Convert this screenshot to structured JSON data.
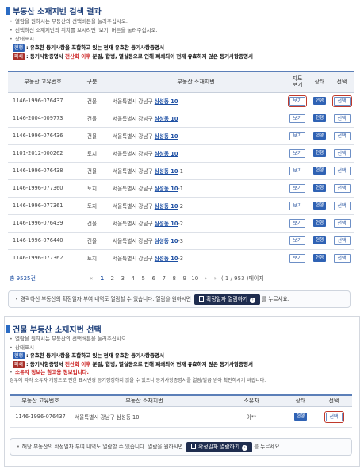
{
  "section1": {
    "title": "부동산 소재지번 검색 결과",
    "bullets": [
      "열람을 원하시는 부동산의 선택버튼을 눌러주십시오.",
      "선택하신 소재지번의 위치를 보시려면 '보기' 버튼을 눌러주십시오.",
      "상태표시"
    ],
    "legend_current_badge": "현행",
    "legend_current_text": ": 유효한 등기사항을 포함하고 있는 현재 유효한 등기사항증명서",
    "legend_closed_badge": "폐쇄",
    "legend_closed_pre": ": 등기사항증명서 ",
    "legend_closed_red": "전산화 이후",
    "legend_closed_post": " 분필, 합병, 멸실등으로 인해 폐쇄되어 현재 유효하지 않은 등기사항증명서",
    "columns": [
      "부동산 고유번호",
      "구분",
      "부동산 소재지번",
      "지도\n보기",
      "상태",
      "선택"
    ],
    "view_label": "보기",
    "status_label": "현행",
    "select_label": "선택",
    "rows": [
      {
        "id": "1146-1996-076437",
        "type": "건물",
        "addr": "서울특별시 강남구 ",
        "link": "삼성동 10",
        "suffix": ""
      },
      {
        "id": "1146-2004-009773",
        "type": "건물",
        "addr": "서울특별시 강남구 ",
        "link": "삼성동 10",
        "suffix": ""
      },
      {
        "id": "1146-1996-076436",
        "type": "건물",
        "addr": "서울특별시 강남구 ",
        "link": "삼성동 10",
        "suffix": ""
      },
      {
        "id": "1101-2012-000262",
        "type": "토지",
        "addr": "서울특별시 강남구 ",
        "link": "삼성동 10",
        "suffix": ""
      },
      {
        "id": "1146-1996-076438",
        "type": "건물",
        "addr": "서울특별시 강남구 ",
        "link": "삼성동 10",
        "suffix": "-1"
      },
      {
        "id": "1146-1996-077360",
        "type": "토지",
        "addr": "서울특별시 강남구 ",
        "link": "삼성동 10",
        "suffix": "-1"
      },
      {
        "id": "1146-1996-077361",
        "type": "토지",
        "addr": "서울특별시 강남구 ",
        "link": "삼성동 10",
        "suffix": "-2"
      },
      {
        "id": "1146-1996-076439",
        "type": "건물",
        "addr": "서울특별시 강남구 ",
        "link": "삼성동 10",
        "suffix": "-2"
      },
      {
        "id": "1146-1996-076440",
        "type": "건물",
        "addr": "서울특별시 강남구 ",
        "link": "삼성동 10",
        "suffix": "-3"
      },
      {
        "id": "1146-1996-077362",
        "type": "토지",
        "addr": "서울특별시 강남구 ",
        "link": "삼성동 10",
        "suffix": "-3"
      }
    ],
    "total": "총 9525건",
    "pages": [
      "1",
      "2",
      "3",
      "4",
      "5",
      "6",
      "7",
      "8",
      "9",
      "10"
    ],
    "current_page": "1",
    "page_info": "( 1 / 953 )페이지",
    "notice_pre": "경락하신 부동산의 확정일자 부여 내역도 열람할 수 있습니다. 열람을 원하시면",
    "notice_button": "확정일자 열람하기",
    "notice_post": "를 누르세요."
  },
  "section2": {
    "title": "건물 부동산 소재지번 선택",
    "bullets": [
      "열람을 원하시는 부동산의 선택버튼을 눌러주십시오.",
      "상태표시"
    ],
    "legend_current_badge": "현행",
    "legend_current_text": ": 유효한 등기사항을 포함하고 있는 현재 유효한 등기사항증명서",
    "legend_closed_badge": "폐쇄",
    "legend_closed_pre": ": 등기사항증명서 ",
    "legend_closed_red": "전산화 이후",
    "legend_closed_post": " 분필, 합병, 멸실등으로 인해 폐쇄되어 현재 유효하지 않은 등기사항증명서",
    "owner_note_title": "소유자 정보는 참고용 정보입니다.",
    "owner_note_text": "경우에 따라 소유자 개명으로 인한 표시변경 등기정정하지 않을 수 있으니 등기사항증명서를 열람/발급 받아 확인하시기 바랍니다.",
    "columns": [
      "부동산 고유번호",
      "부동산 소재지번",
      "소유자",
      "상태",
      "선택"
    ],
    "row": {
      "id": "1146-1996-076437",
      "addr": "서울특별시 강남구 삼성동 10",
      "owner": "이**",
      "status": "현행",
      "select": "선택"
    },
    "notice_pre": "해당 부동산의 확정일자 부여 내역도 열람할 수 있습니다. 열람을 원하시면",
    "notice_button": "확정일자 열람하기",
    "notice_post": "를 누르세요."
  },
  "colors": {
    "accent": "#2b6cc4",
    "title": "#1d3f7a",
    "badge_current": "#2f62b4",
    "badge_closed": "#a8302a",
    "highlight": "#c0392b",
    "button_dark": "#1f2d4f"
  }
}
